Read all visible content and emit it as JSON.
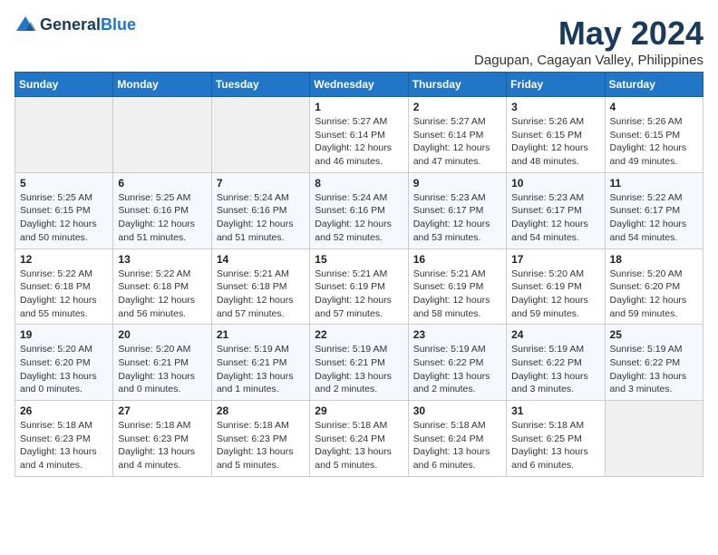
{
  "logo": {
    "line1": "General",
    "line2": "Blue"
  },
  "title": "May 2024",
  "location": "Dagupan, Cagayan Valley, Philippines",
  "weekdays": [
    "Sunday",
    "Monday",
    "Tuesday",
    "Wednesday",
    "Thursday",
    "Friday",
    "Saturday"
  ],
  "weeks": [
    [
      {
        "day": "",
        "info": ""
      },
      {
        "day": "",
        "info": ""
      },
      {
        "day": "",
        "info": ""
      },
      {
        "day": "1",
        "info": "Sunrise: 5:27 AM\nSunset: 6:14 PM\nDaylight: 12 hours and 46 minutes."
      },
      {
        "day": "2",
        "info": "Sunrise: 5:27 AM\nSunset: 6:14 PM\nDaylight: 12 hours and 47 minutes."
      },
      {
        "day": "3",
        "info": "Sunrise: 5:26 AM\nSunset: 6:15 PM\nDaylight: 12 hours and 48 minutes."
      },
      {
        "day": "4",
        "info": "Sunrise: 5:26 AM\nSunset: 6:15 PM\nDaylight: 12 hours and 49 minutes."
      }
    ],
    [
      {
        "day": "5",
        "info": "Sunrise: 5:25 AM\nSunset: 6:15 PM\nDaylight: 12 hours and 50 minutes."
      },
      {
        "day": "6",
        "info": "Sunrise: 5:25 AM\nSunset: 6:16 PM\nDaylight: 12 hours and 51 minutes."
      },
      {
        "day": "7",
        "info": "Sunrise: 5:24 AM\nSunset: 6:16 PM\nDaylight: 12 hours and 51 minutes."
      },
      {
        "day": "8",
        "info": "Sunrise: 5:24 AM\nSunset: 6:16 PM\nDaylight: 12 hours and 52 minutes."
      },
      {
        "day": "9",
        "info": "Sunrise: 5:23 AM\nSunset: 6:17 PM\nDaylight: 12 hours and 53 minutes."
      },
      {
        "day": "10",
        "info": "Sunrise: 5:23 AM\nSunset: 6:17 PM\nDaylight: 12 hours and 54 minutes."
      },
      {
        "day": "11",
        "info": "Sunrise: 5:22 AM\nSunset: 6:17 PM\nDaylight: 12 hours and 54 minutes."
      }
    ],
    [
      {
        "day": "12",
        "info": "Sunrise: 5:22 AM\nSunset: 6:18 PM\nDaylight: 12 hours and 55 minutes."
      },
      {
        "day": "13",
        "info": "Sunrise: 5:22 AM\nSunset: 6:18 PM\nDaylight: 12 hours and 56 minutes."
      },
      {
        "day": "14",
        "info": "Sunrise: 5:21 AM\nSunset: 6:18 PM\nDaylight: 12 hours and 57 minutes."
      },
      {
        "day": "15",
        "info": "Sunrise: 5:21 AM\nSunset: 6:19 PM\nDaylight: 12 hours and 57 minutes."
      },
      {
        "day": "16",
        "info": "Sunrise: 5:21 AM\nSunset: 6:19 PM\nDaylight: 12 hours and 58 minutes."
      },
      {
        "day": "17",
        "info": "Sunrise: 5:20 AM\nSunset: 6:19 PM\nDaylight: 12 hours and 59 minutes."
      },
      {
        "day": "18",
        "info": "Sunrise: 5:20 AM\nSunset: 6:20 PM\nDaylight: 12 hours and 59 minutes."
      }
    ],
    [
      {
        "day": "19",
        "info": "Sunrise: 5:20 AM\nSunset: 6:20 PM\nDaylight: 13 hours and 0 minutes."
      },
      {
        "day": "20",
        "info": "Sunrise: 5:20 AM\nSunset: 6:21 PM\nDaylight: 13 hours and 0 minutes."
      },
      {
        "day": "21",
        "info": "Sunrise: 5:19 AM\nSunset: 6:21 PM\nDaylight: 13 hours and 1 minutes."
      },
      {
        "day": "22",
        "info": "Sunrise: 5:19 AM\nSunset: 6:21 PM\nDaylight: 13 hours and 2 minutes."
      },
      {
        "day": "23",
        "info": "Sunrise: 5:19 AM\nSunset: 6:22 PM\nDaylight: 13 hours and 2 minutes."
      },
      {
        "day": "24",
        "info": "Sunrise: 5:19 AM\nSunset: 6:22 PM\nDaylight: 13 hours and 3 minutes."
      },
      {
        "day": "25",
        "info": "Sunrise: 5:19 AM\nSunset: 6:22 PM\nDaylight: 13 hours and 3 minutes."
      }
    ],
    [
      {
        "day": "26",
        "info": "Sunrise: 5:18 AM\nSunset: 6:23 PM\nDaylight: 13 hours and 4 minutes."
      },
      {
        "day": "27",
        "info": "Sunrise: 5:18 AM\nSunset: 6:23 PM\nDaylight: 13 hours and 4 minutes."
      },
      {
        "day": "28",
        "info": "Sunrise: 5:18 AM\nSunset: 6:23 PM\nDaylight: 13 hours and 5 minutes."
      },
      {
        "day": "29",
        "info": "Sunrise: 5:18 AM\nSunset: 6:24 PM\nDaylight: 13 hours and 5 minutes."
      },
      {
        "day": "30",
        "info": "Sunrise: 5:18 AM\nSunset: 6:24 PM\nDaylight: 13 hours and 6 minutes."
      },
      {
        "day": "31",
        "info": "Sunrise: 5:18 AM\nSunset: 6:25 PM\nDaylight: 13 hours and 6 minutes."
      },
      {
        "day": "",
        "info": ""
      }
    ]
  ]
}
